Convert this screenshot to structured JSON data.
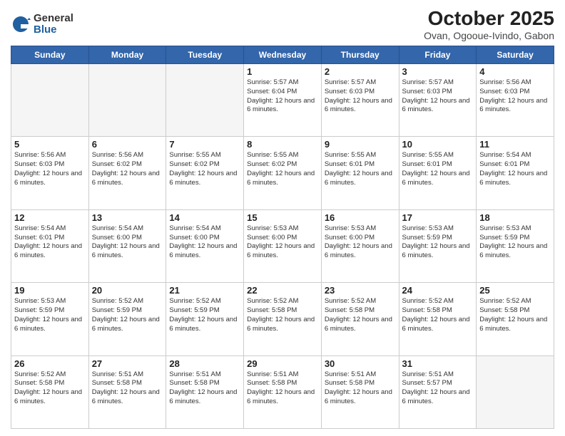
{
  "logo": {
    "general": "General",
    "blue": "Blue"
  },
  "title": "October 2025",
  "subtitle": "Ovan, Ogooue-Ivindo, Gabon",
  "headers": [
    "Sunday",
    "Monday",
    "Tuesday",
    "Wednesday",
    "Thursday",
    "Friday",
    "Saturday"
  ],
  "weeks": [
    [
      {
        "day": "",
        "info": ""
      },
      {
        "day": "",
        "info": ""
      },
      {
        "day": "",
        "info": ""
      },
      {
        "day": "1",
        "info": "Sunrise: 5:57 AM\nSunset: 6:04 PM\nDaylight: 12 hours and 6 minutes."
      },
      {
        "day": "2",
        "info": "Sunrise: 5:57 AM\nSunset: 6:03 PM\nDaylight: 12 hours and 6 minutes."
      },
      {
        "day": "3",
        "info": "Sunrise: 5:57 AM\nSunset: 6:03 PM\nDaylight: 12 hours and 6 minutes."
      },
      {
        "day": "4",
        "info": "Sunrise: 5:56 AM\nSunset: 6:03 PM\nDaylight: 12 hours and 6 minutes."
      }
    ],
    [
      {
        "day": "5",
        "info": "Sunrise: 5:56 AM\nSunset: 6:03 PM\nDaylight: 12 hours and 6 minutes."
      },
      {
        "day": "6",
        "info": "Sunrise: 5:56 AM\nSunset: 6:02 PM\nDaylight: 12 hours and 6 minutes."
      },
      {
        "day": "7",
        "info": "Sunrise: 5:55 AM\nSunset: 6:02 PM\nDaylight: 12 hours and 6 minutes."
      },
      {
        "day": "8",
        "info": "Sunrise: 5:55 AM\nSunset: 6:02 PM\nDaylight: 12 hours and 6 minutes."
      },
      {
        "day": "9",
        "info": "Sunrise: 5:55 AM\nSunset: 6:01 PM\nDaylight: 12 hours and 6 minutes."
      },
      {
        "day": "10",
        "info": "Sunrise: 5:55 AM\nSunset: 6:01 PM\nDaylight: 12 hours and 6 minutes."
      },
      {
        "day": "11",
        "info": "Sunrise: 5:54 AM\nSunset: 6:01 PM\nDaylight: 12 hours and 6 minutes."
      }
    ],
    [
      {
        "day": "12",
        "info": "Sunrise: 5:54 AM\nSunset: 6:01 PM\nDaylight: 12 hours and 6 minutes."
      },
      {
        "day": "13",
        "info": "Sunrise: 5:54 AM\nSunset: 6:00 PM\nDaylight: 12 hours and 6 minutes."
      },
      {
        "day": "14",
        "info": "Sunrise: 5:54 AM\nSunset: 6:00 PM\nDaylight: 12 hours and 6 minutes."
      },
      {
        "day": "15",
        "info": "Sunrise: 5:53 AM\nSunset: 6:00 PM\nDaylight: 12 hours and 6 minutes."
      },
      {
        "day": "16",
        "info": "Sunrise: 5:53 AM\nSunset: 6:00 PM\nDaylight: 12 hours and 6 minutes."
      },
      {
        "day": "17",
        "info": "Sunrise: 5:53 AM\nSunset: 5:59 PM\nDaylight: 12 hours and 6 minutes."
      },
      {
        "day": "18",
        "info": "Sunrise: 5:53 AM\nSunset: 5:59 PM\nDaylight: 12 hours and 6 minutes."
      }
    ],
    [
      {
        "day": "19",
        "info": "Sunrise: 5:53 AM\nSunset: 5:59 PM\nDaylight: 12 hours and 6 minutes."
      },
      {
        "day": "20",
        "info": "Sunrise: 5:52 AM\nSunset: 5:59 PM\nDaylight: 12 hours and 6 minutes."
      },
      {
        "day": "21",
        "info": "Sunrise: 5:52 AM\nSunset: 5:59 PM\nDaylight: 12 hours and 6 minutes."
      },
      {
        "day": "22",
        "info": "Sunrise: 5:52 AM\nSunset: 5:58 PM\nDaylight: 12 hours and 6 minutes."
      },
      {
        "day": "23",
        "info": "Sunrise: 5:52 AM\nSunset: 5:58 PM\nDaylight: 12 hours and 6 minutes."
      },
      {
        "day": "24",
        "info": "Sunrise: 5:52 AM\nSunset: 5:58 PM\nDaylight: 12 hours and 6 minutes."
      },
      {
        "day": "25",
        "info": "Sunrise: 5:52 AM\nSunset: 5:58 PM\nDaylight: 12 hours and 6 minutes."
      }
    ],
    [
      {
        "day": "26",
        "info": "Sunrise: 5:52 AM\nSunset: 5:58 PM\nDaylight: 12 hours and 6 minutes."
      },
      {
        "day": "27",
        "info": "Sunrise: 5:51 AM\nSunset: 5:58 PM\nDaylight: 12 hours and 6 minutes."
      },
      {
        "day": "28",
        "info": "Sunrise: 5:51 AM\nSunset: 5:58 PM\nDaylight: 12 hours and 6 minutes."
      },
      {
        "day": "29",
        "info": "Sunrise: 5:51 AM\nSunset: 5:58 PM\nDaylight: 12 hours and 6 minutes."
      },
      {
        "day": "30",
        "info": "Sunrise: 5:51 AM\nSunset: 5:58 PM\nDaylight: 12 hours and 6 minutes."
      },
      {
        "day": "31",
        "info": "Sunrise: 5:51 AM\nSunset: 5:57 PM\nDaylight: 12 hours and 6 minutes."
      },
      {
        "day": "",
        "info": ""
      }
    ]
  ]
}
